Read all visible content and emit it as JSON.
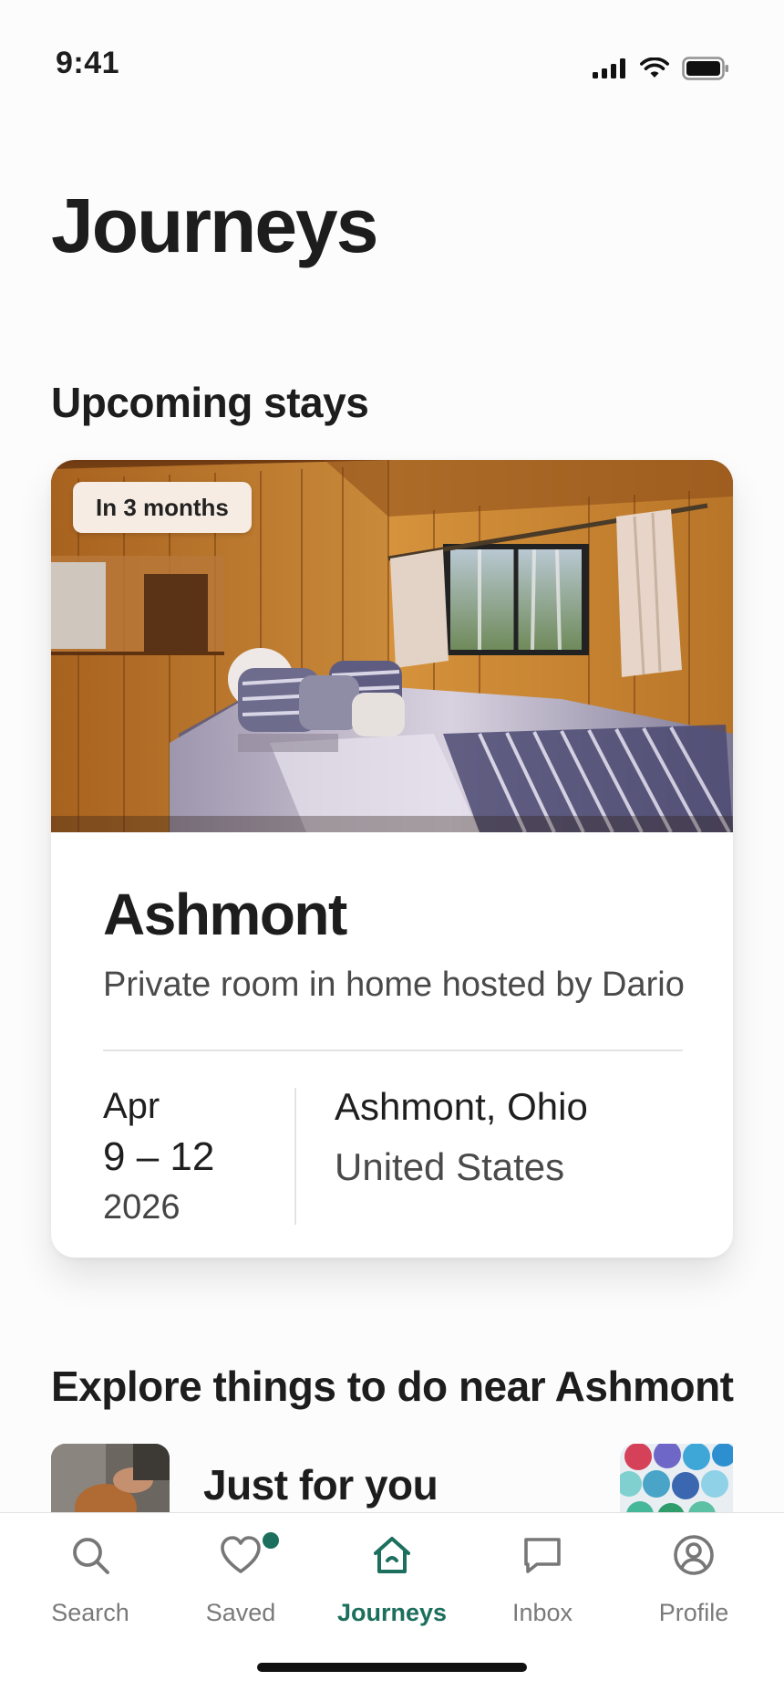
{
  "status_bar": {
    "time": "9:41"
  },
  "page": {
    "title": "Journeys"
  },
  "upcoming": {
    "section_title": "Upcoming stays",
    "stay": {
      "badge": "In 3 months",
      "name": "Ashmont",
      "description": "Private room in home hosted by Dario",
      "date_month": "Apr",
      "date_range": "9 – 12",
      "date_year": "2026",
      "location_city": "Ashmont, Ohio",
      "location_country": "United States"
    }
  },
  "explore": {
    "section_title": "Explore things to do near Ashmont",
    "row_title": "Just for you"
  },
  "tab_bar": {
    "active_color": "#1b6f5c",
    "tabs": [
      {
        "label": "Search",
        "icon": "search-icon"
      },
      {
        "label": "Saved",
        "icon": "heart-icon",
        "has_notification": true
      },
      {
        "label": "Journeys",
        "icon": "home-icon",
        "active": true
      },
      {
        "label": "Inbox",
        "icon": "message-icon"
      },
      {
        "label": "Profile",
        "icon": "profile-icon"
      }
    ]
  }
}
